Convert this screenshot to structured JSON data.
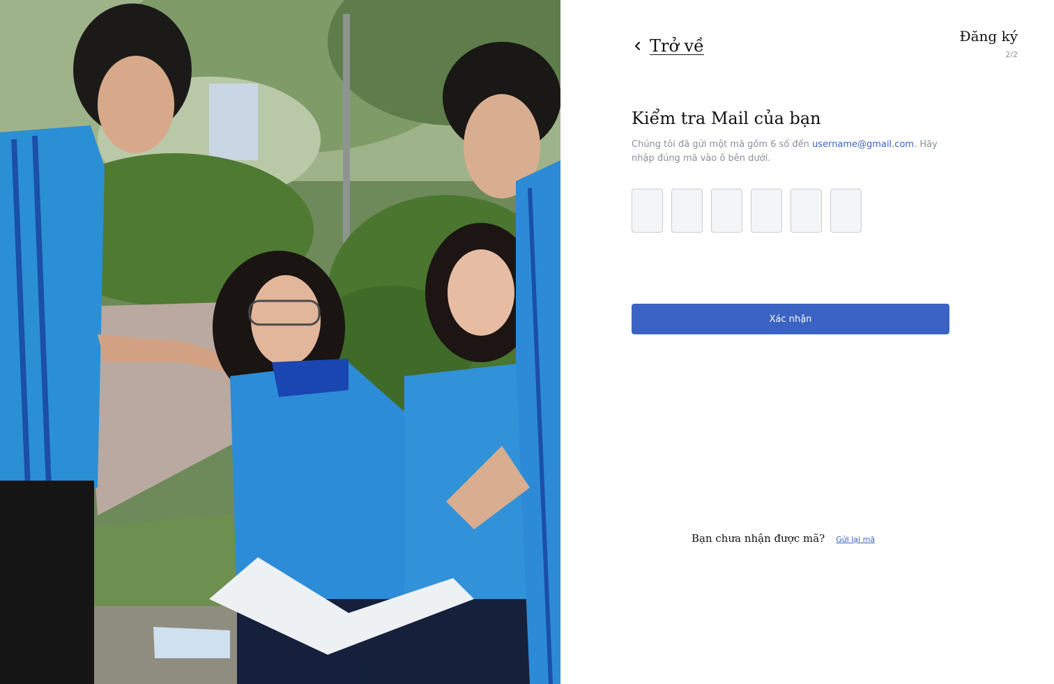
{
  "photo": {
    "alt": "Students in blue uniforms studying outdoors"
  },
  "header": {
    "back_label": "Trở về",
    "step_title": "Đăng ký",
    "step_count": "2/2"
  },
  "main": {
    "heading": "Kiểm tra Mail của bạn",
    "desc_before": "Chúng tôi đã gửi một mã gồm 6 số đến ",
    "email": "username@gmail.com",
    "desc_after": ". Hãy nhập đúng mã vào ô bên dưới.",
    "otp_values": [
      "",
      "",
      "",
      "",
      "",
      ""
    ],
    "confirm_label": "Xác nhận"
  },
  "footer": {
    "question": "Bạn chưa nhận được mã?",
    "resend_label": "Gửi lại mã"
  },
  "colors": {
    "accent": "#3a63c4",
    "muted_text": "#8a8f99",
    "otp_bg": "#f4f5f7",
    "otp_border": "#c9ccd3"
  }
}
